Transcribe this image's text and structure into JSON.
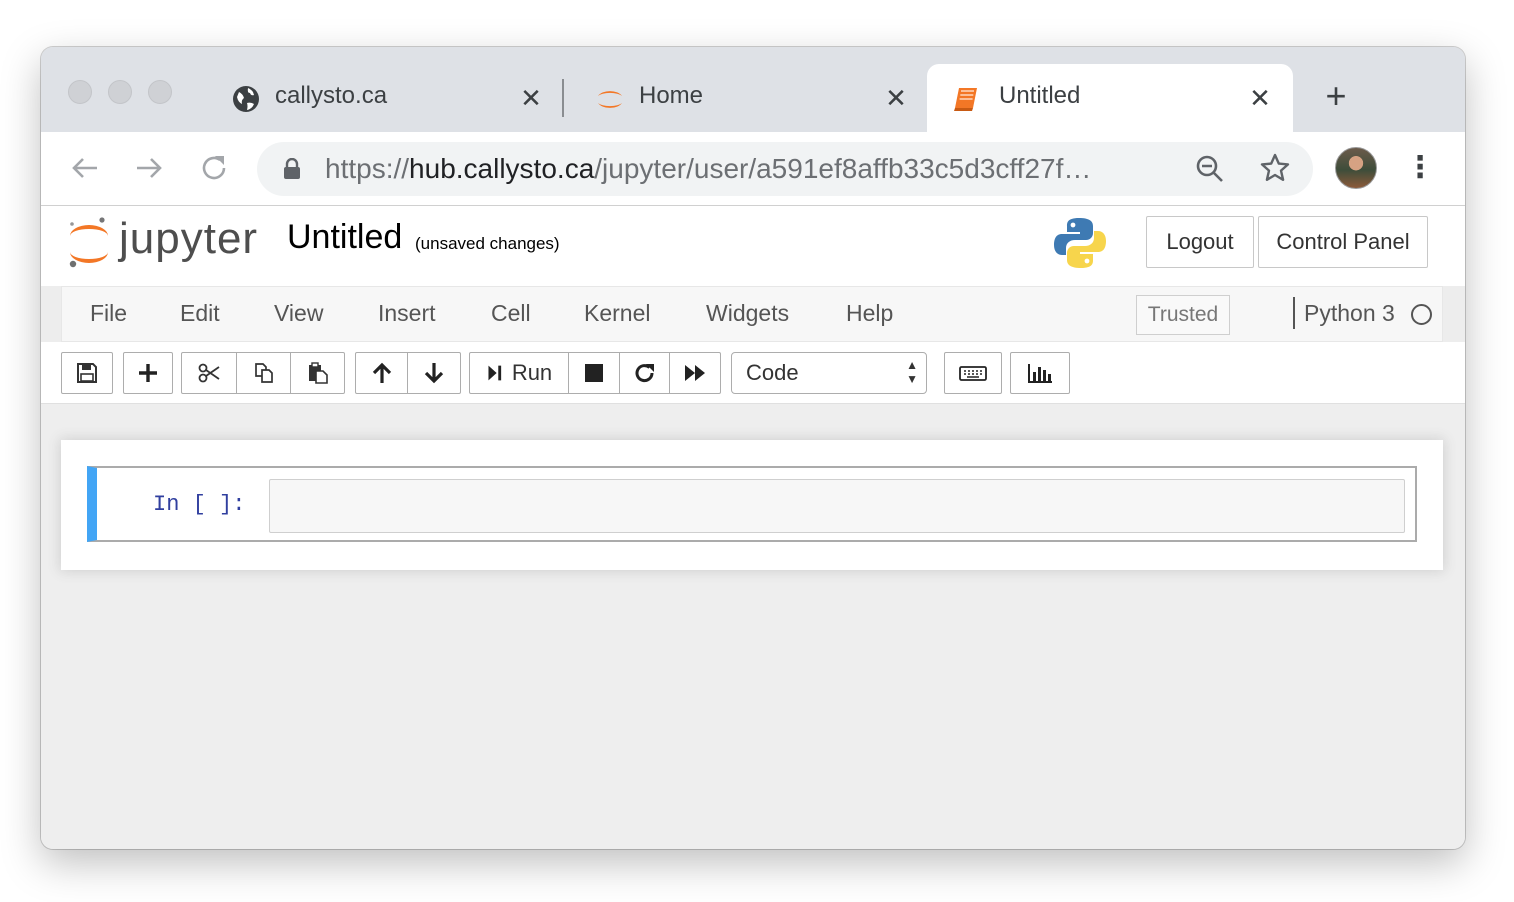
{
  "browser": {
    "tabs": [
      {
        "title": "callysto.ca",
        "icon": "globe-icon",
        "active": false
      },
      {
        "title": "Home",
        "icon": "jupyter-icon",
        "active": false
      },
      {
        "title": "Untitled",
        "icon": "notebook-icon",
        "active": true
      }
    ],
    "new_tab_symbol": "+",
    "url_scheme": "https://",
    "url_host": "hub.callysto.ca",
    "url_path": "/jupyter/user/a591ef8affb33c5d3cff27f…"
  },
  "jupyter": {
    "logo_text": "jupyter",
    "notebook_title": "Untitled",
    "save_status": "(unsaved changes)",
    "logout_label": "Logout",
    "control_panel_label": "Control Panel",
    "menu": [
      "File",
      "Edit",
      "View",
      "Insert",
      "Cell",
      "Kernel",
      "Widgets",
      "Help"
    ],
    "trusted_label": "Trusted",
    "kernel_name": "Python 3",
    "kernel_state": "idle"
  },
  "toolbar": {
    "run_label": "Run",
    "cell_type": "Code"
  },
  "cell": {
    "prompt": "In [ ]:",
    "source": ""
  },
  "colors": {
    "accent_orange": "#f37726",
    "cell_selected": "#42a5f5",
    "prompt_blue": "#303f9f"
  }
}
